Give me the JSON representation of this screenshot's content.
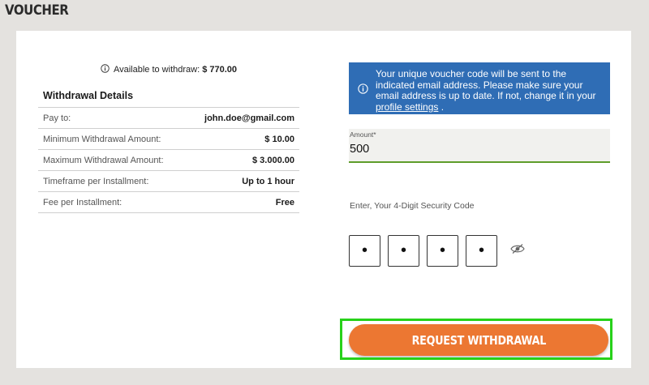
{
  "page": {
    "title": "VOUCHER"
  },
  "available": {
    "label": "Available to withdraw:",
    "amount": "$ 770.00",
    "icon": "info-icon"
  },
  "details": {
    "title": "Withdrawal Details",
    "rows": [
      {
        "label": "Pay to:",
        "value": "john.doe@gmail.com"
      },
      {
        "label": "Minimum Withdrawal Amount:",
        "value": "$ 10.00"
      },
      {
        "label": "Maximum Withdrawal Amount:",
        "value": "$ 3.000.00"
      },
      {
        "label": "Timeframe per Installment:",
        "value": "Up to 1 hour"
      },
      {
        "label": "Fee per Installment:",
        "value": "Free"
      }
    ]
  },
  "notice": {
    "text": "Your unique voucher code will be sent to the indicated email address. Please make sure your email address is up to date. If not, change it in your",
    "link": "profile settings",
    "end": ".",
    "bg_color": "#2f6db5"
  },
  "amount": {
    "label": "Amount*",
    "value": "500"
  },
  "security": {
    "prompt": "Enter, Your 4-Digit Security Code",
    "pins": [
      "•",
      "•",
      "•",
      "•"
    ],
    "toggle_icon": "eye-slash-icon"
  },
  "actions": {
    "request_label": "REQUEST WITHDRAWAL",
    "button_color": "#ec7732",
    "highlight_color": "#27d11a"
  }
}
